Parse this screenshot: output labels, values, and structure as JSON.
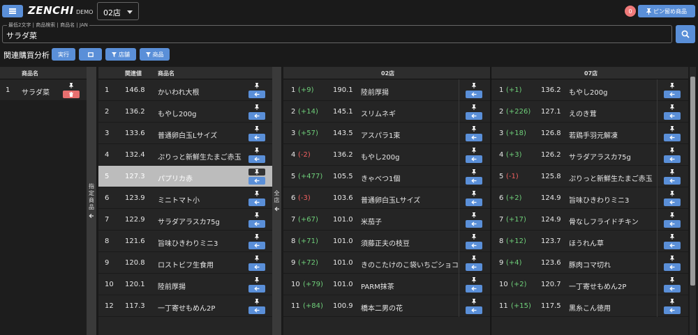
{
  "header": {
    "logo": "ZENCHI",
    "logo_suffix": "DEMO",
    "store_select": "02店",
    "pin_count": "0",
    "pin_list_label": "ピン留め商品"
  },
  "search": {
    "legend": "最低2文字 | 商品検索 | 商品名 | JAN",
    "value": "サラダ菜"
  },
  "toolbar": {
    "title": "関連購買分析",
    "run_label": "実行",
    "store_filter_label": "店舗",
    "item_filter_label": "商品"
  },
  "left_panel": {
    "header_name": "商品名",
    "vertical_label": "指定商品",
    "rows": [
      {
        "rank": "1",
        "name": "サラダ菜"
      }
    ]
  },
  "middle_panel": {
    "header_score": "関連値",
    "header_name": "商品名",
    "vertical_label": "全店",
    "rows": [
      {
        "rank": "1",
        "score": "146.8",
        "name": "かいわれ大根"
      },
      {
        "rank": "2",
        "score": "136.2",
        "name": "もやし200g"
      },
      {
        "rank": "3",
        "score": "133.6",
        "name": "普通卵白玉Lサイズ"
      },
      {
        "rank": "4",
        "score": "132.4",
        "name": "ぷりっと新鮮生たまご赤玉"
      },
      {
        "rank": "5",
        "score": "127.3",
        "name": "パプリカ赤"
      },
      {
        "rank": "6",
        "score": "123.9",
        "name": "ミニトマト小"
      },
      {
        "rank": "7",
        "score": "122.9",
        "name": "サラダアラスカ75g"
      },
      {
        "rank": "8",
        "score": "121.6",
        "name": "旨味ひきわりミニ3"
      },
      {
        "rank": "9",
        "score": "120.8",
        "name": "ロストビフ生食用"
      },
      {
        "rank": "10",
        "score": "120.1",
        "name": "陸前厚揚"
      },
      {
        "rank": "12",
        "score": "117.3",
        "name": "一丁寄せもめん2P"
      }
    ]
  },
  "store_02": {
    "header": "02店",
    "rows": [
      {
        "rank": "1",
        "delta": "(+9)",
        "score": "190.1",
        "name": "陸前厚揚"
      },
      {
        "rank": "2",
        "delta": "(+14)",
        "score": "145.1",
        "name": "スリムネギ"
      },
      {
        "rank": "3",
        "delta": "(+57)",
        "score": "143.5",
        "name": "アスパラ1束"
      },
      {
        "rank": "4",
        "delta": "(-2)",
        "score": "136.2",
        "name": "もやし200g"
      },
      {
        "rank": "5",
        "delta": "(+477)",
        "score": "105.5",
        "name": "きゃべつ1個"
      },
      {
        "rank": "6",
        "delta": "(-3)",
        "score": "103.6",
        "name": "普通卵白玉Lサイズ"
      },
      {
        "rank": "7",
        "delta": "(+67)",
        "score": "101.0",
        "name": "米茄子"
      },
      {
        "rank": "8",
        "delta": "(+71)",
        "score": "101.0",
        "name": "須藤正夫の枝豆"
      },
      {
        "rank": "9",
        "delta": "(+72)",
        "score": "101.0",
        "name": "きのこたけのこ袋いちごショコ"
      },
      {
        "rank": "10",
        "delta": "(+79)",
        "score": "101.0",
        "name": "PARM抹茶"
      },
      {
        "rank": "11",
        "delta": "(+84)",
        "score": "100.9",
        "name": "橋本二男の花"
      }
    ]
  },
  "store_07": {
    "header": "07店",
    "rows": [
      {
        "rank": "1",
        "delta": "(+1)",
        "score": "136.2",
        "name": "もやし200g"
      },
      {
        "rank": "2",
        "delta": "(+226)",
        "score": "127.1",
        "name": "えのき茸"
      },
      {
        "rank": "3",
        "delta": "(+18)",
        "score": "126.8",
        "name": "若鶏手羽元解凍"
      },
      {
        "rank": "4",
        "delta": "(+3)",
        "score": "126.2",
        "name": "サラダアラスカ75g"
      },
      {
        "rank": "5",
        "delta": "(-1)",
        "score": "125.8",
        "name": "ぷりっと新鮮生たまご赤玉"
      },
      {
        "rank": "6",
        "delta": "(+2)",
        "score": "124.9",
        "name": "旨味ひきわりミニ3"
      },
      {
        "rank": "7",
        "delta": "(+17)",
        "score": "124.9",
        "name": "骨なしフライドチキン"
      },
      {
        "rank": "8",
        "delta": "(+12)",
        "score": "123.7",
        "name": "ほうれん草"
      },
      {
        "rank": "9",
        "delta": "(+4)",
        "score": "123.6",
        "name": "豚肉コマ切れ"
      },
      {
        "rank": "10",
        "delta": "(+2)",
        "score": "120.7",
        "name": "一丁寄せもめん2P"
      },
      {
        "rank": "11",
        "delta": "(+15)",
        "score": "117.5",
        "name": "黒糸こん徳用"
      }
    ]
  },
  "colors": {
    "accent": "#5a8fd8",
    "positive": "#6fd07a",
    "negative": "#f06060",
    "selected_row": "#bcbcbc"
  }
}
